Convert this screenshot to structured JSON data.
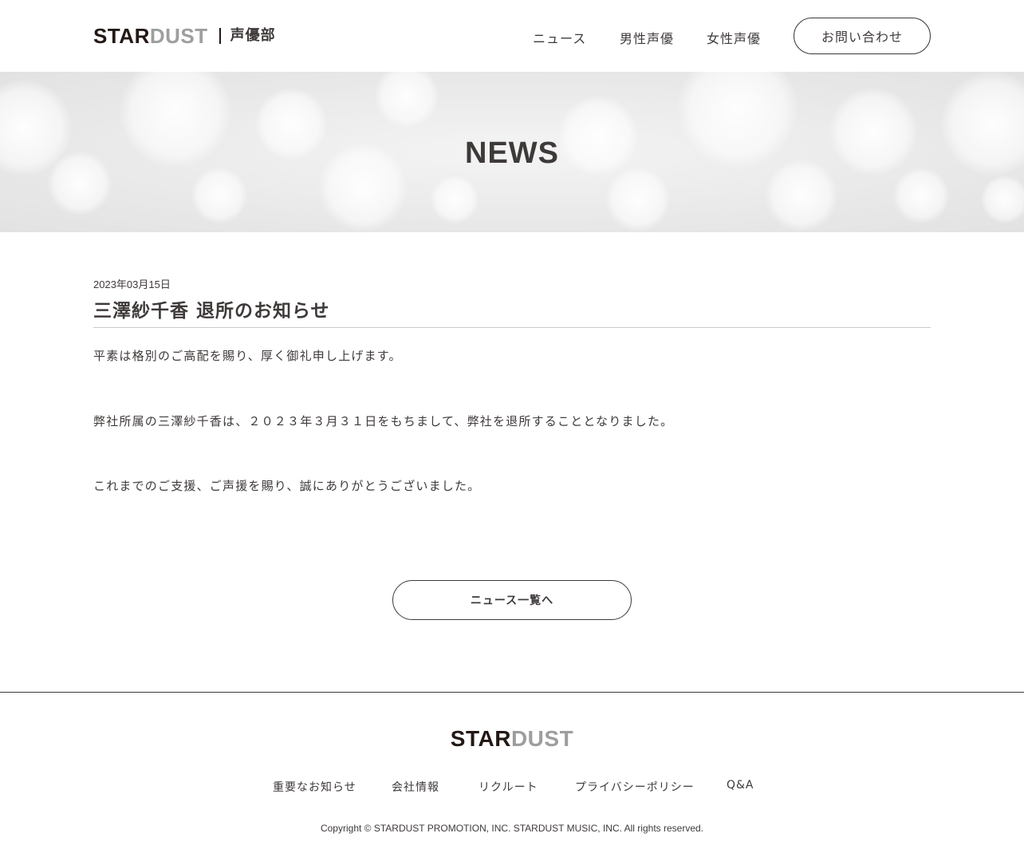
{
  "header": {
    "logo_star": "STAR",
    "logo_dust": "DUST",
    "logo_sub": "声優部",
    "nav": {
      "news": "ニュース",
      "male": "男性声優",
      "female": "女性声優"
    },
    "contact_label": "お問い合わせ"
  },
  "hero": {
    "title": "NEWS"
  },
  "article": {
    "date": "2023年03月15日",
    "title": "三澤紗千香 退所のお知らせ",
    "paragraphs": [
      "平素は格別のご高配を賜り、厚く御礼申し上げます。",
      "弊社所属の三澤紗千香は、２０２３年３月３１日をもちまして、弊社を退所することとなりました。",
      "これまでのご支援、ご声援を賜り、誠にありがとうございました。"
    ],
    "back_label": "ニュース一覧へ"
  },
  "footer": {
    "logo_star": "STAR",
    "logo_dust": "DUST",
    "nav": [
      "重要なお知らせ",
      "会社情報",
      "リクルート",
      "プライバシーポリシー",
      "Q&A"
    ],
    "copyright": "Copyright © STARDUST PROMOTION, INC. STARDUST MUSIC, INC. All rights reserved."
  },
  "colors": {
    "text": "#3e3a39",
    "logo_dark": "#231815",
    "logo_gray": "#9e9e9f"
  }
}
